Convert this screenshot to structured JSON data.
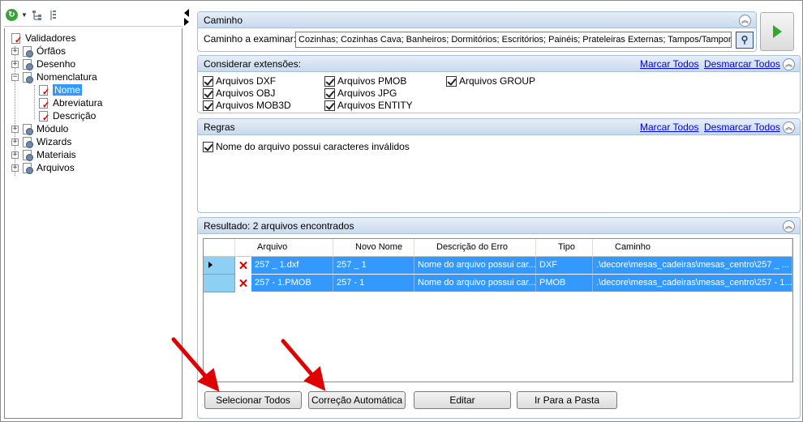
{
  "tree": {
    "root": "Validadores",
    "items": [
      "Órfãos",
      "Desenho",
      "Nomenclatura",
      "Nome",
      "Abreviatura",
      "Descrição",
      "Módulo",
      "Wizards",
      "Materiais",
      "Arquivos"
    ]
  },
  "caminho": {
    "title": "Caminho",
    "label": "Caminho a examinar:",
    "value": "Cozinhas; Cozinhas Cava; Banheiros; Dormitórios; Escritórios; Painéis; Prateleiras Externas; Tampos/Tamponamento"
  },
  "extensoes": {
    "title": "Considerar extensões:",
    "mark_all": "Marcar Todos",
    "unmark_all": "Desmarcar Todos",
    "items": [
      "Arquivos DXF",
      "Arquivos PMOB",
      "Arquivos GROUP",
      "Arquivos OBJ",
      "Arquivos JPG",
      "Arquivos MOB3D",
      "Arquivos ENTITY"
    ]
  },
  "regras": {
    "title": "Regras",
    "mark_all": "Marcar Todos",
    "unmark_all": "Desmarcar Todos",
    "items": [
      "Nome do arquivo possui caracteres inválidos"
    ]
  },
  "resultado": {
    "title": "Resultado: 2 arquivos encontrados",
    "columns": [
      "Arquivo",
      "Novo Nome",
      "Descrição do Erro",
      "Tipo",
      "Caminho"
    ],
    "rows": [
      [
        "257 _ 1.dxf",
        "257 _ 1",
        "Nome do arquivo possui car...",
        "DXF",
        ".\\decore\\mesas_cadeiras\\mesas_centro\\257 _ ..."
      ],
      [
        "257 - 1.PMOB",
        "257 - 1",
        "Nome do arquivo possui car...",
        "PMOB",
        ".\\decore\\mesas_cadeiras\\mesas_centro\\257 - 1..."
      ]
    ]
  },
  "buttons": {
    "select_all": "Selecionar Todos",
    "auto_fix": "Correção Automática",
    "edit": "Editar",
    "go_folder": "Ir Para a Pasta"
  },
  "colors": {
    "accent": "#3399ff",
    "annotation": "#e00000",
    "panel_header": "#c9d9ed"
  }
}
